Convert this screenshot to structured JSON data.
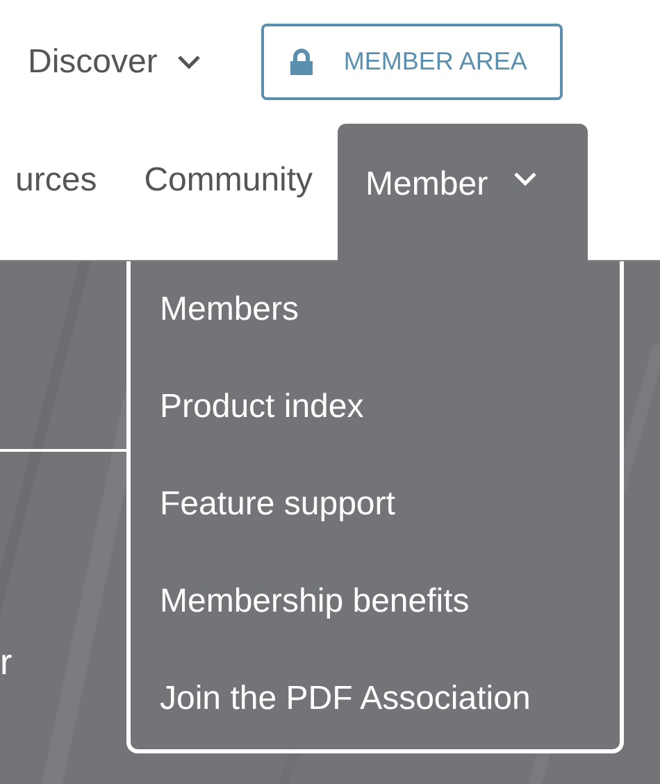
{
  "header": {
    "discover": {
      "label": "Discover"
    },
    "member_area_button": {
      "label": "MEMBER AREA"
    }
  },
  "nav": {
    "items": [
      {
        "label": "urces",
        "selected": false
      },
      {
        "label": "Community",
        "selected": false
      },
      {
        "label": "Member",
        "selected": true
      }
    ]
  },
  "dropdown": {
    "items": [
      {
        "label": "Members"
      },
      {
        "label": "Product index"
      },
      {
        "label": "Feature support"
      },
      {
        "label": "Membership benefits"
      },
      {
        "label": "Join the PDF Association"
      }
    ]
  },
  "hero": {
    "text_fragment": "r"
  }
}
